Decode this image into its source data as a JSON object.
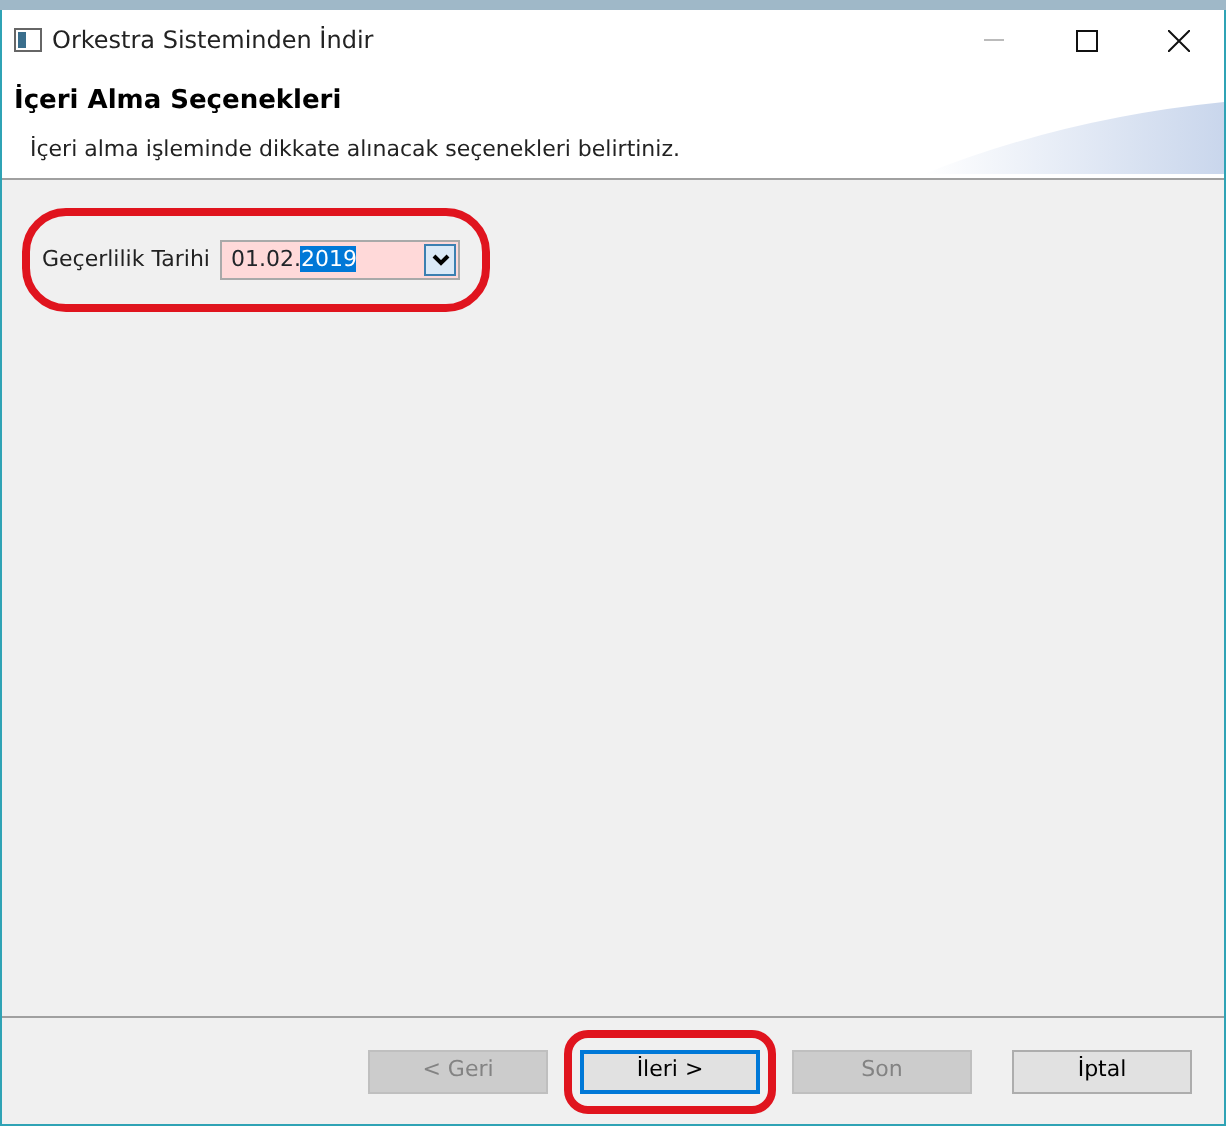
{
  "window": {
    "title": "Orkestra Sisteminden İndir"
  },
  "header": {
    "title": "İçeri Alma Seçenekleri",
    "description": "İçeri alma işleminde dikkate alınacak seçenekleri belirtiniz."
  },
  "date_field": {
    "label": "Geçerlilik Tarihi",
    "invalid": true,
    "value_parts": [
      {
        "text": "01.02.",
        "selected": false
      },
      {
        "text": "2019",
        "selected": true
      }
    ],
    "highlighted": true
  },
  "buttons": [
    {
      "label": "< Geri",
      "disabled": true,
      "focused": false,
      "highlighted": false
    },
    {
      "label": "İleri >",
      "disabled": false,
      "focused": true,
      "highlighted": true
    },
    {
      "label": "Son",
      "disabled": true,
      "focused": false,
      "highlighted": false
    },
    {
      "label": "İptal",
      "disabled": false,
      "focused": false,
      "highlighted": false
    }
  ]
}
